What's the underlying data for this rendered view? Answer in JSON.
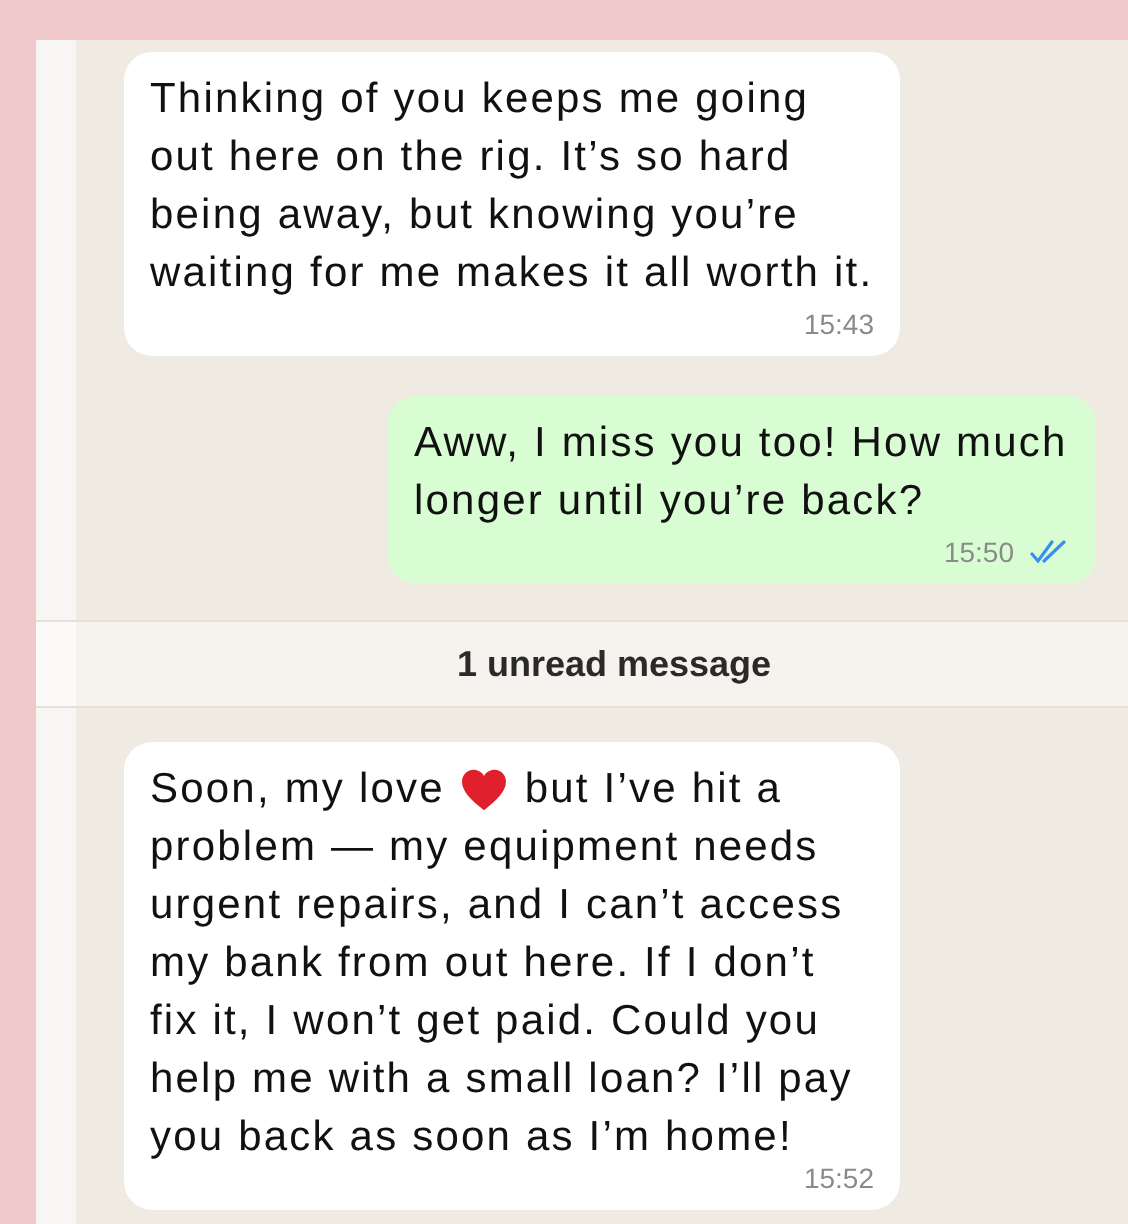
{
  "messages": [
    {
      "kind": "incoming",
      "parts": [
        {
          "kind": "text",
          "text": "Thinking of you keeps me going out here on the rig. It’s so hard being away, but knowing you’re waiting for me makes it all worth it."
        }
      ],
      "time": "15:43"
    },
    {
      "kind": "outgoing",
      "parts": [
        {
          "kind": "text",
          "text": "Aww, I miss you too! How much longer until you’re back?"
        }
      ],
      "time": "15:50",
      "read": true
    },
    {
      "kind": "divider",
      "text": "1 unread message"
    },
    {
      "kind": "incoming",
      "parts": [
        {
          "kind": "text",
          "text": "Soon, my love"
        },
        {
          "kind": "heart"
        },
        {
          "kind": "text",
          "text": "but I’ve hit a"
        },
        {
          "kind": "text",
          "text": "problem — my equipment needs urgent repairs, and I can’t access my bank from out here. If I don’t fix it, I won’t get paid. Could you help me with a small loan? I’ll pay you back as soon as I’m home!"
        }
      ],
      "time": "15:52"
    }
  ]
}
